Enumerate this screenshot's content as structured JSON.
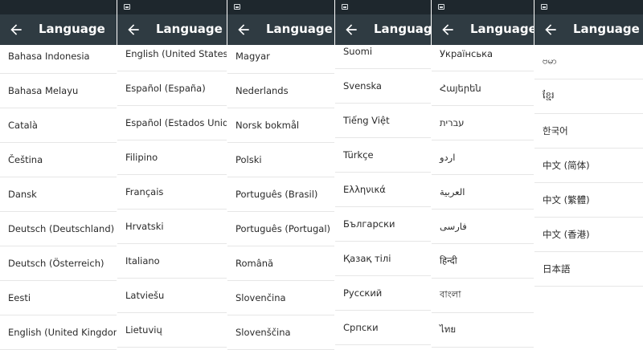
{
  "header_title": "Language",
  "panels": [
    {
      "items": [
        "Bahasa Indonesia",
        "Bahasa Melayu",
        "Català",
        "Čeština",
        "Dansk",
        "Deutsch (Deutschland)",
        "Deutsch (Österreich)",
        "Eesti",
        "English (United Kingdom)"
      ]
    },
    {
      "items": [
        "English (United States)",
        "Español (España)",
        "Español (Estados Unidos)",
        "Filipino",
        "Français",
        "Hrvatski",
        "Italiano",
        "Latviešu",
        "Lietuvių"
      ]
    },
    {
      "items": [
        "Magyar",
        "Nederlands",
        "Norsk bokmål",
        "Polski",
        "Português (Brasil)",
        "Português (Portugal)",
        "Română",
        "Slovenčina",
        "Slovenščina"
      ]
    },
    {
      "items": [
        "Suomi",
        "Svenska",
        "Tiếng Việt",
        "Türkçe",
        "Ελληνικά",
        "Български",
        "Қазақ тілі",
        "Русский",
        "Српски"
      ]
    },
    {
      "items": [
        "Українська",
        "Հայերեն",
        "עברית",
        "اردو",
        "العربية",
        "فارسی",
        "हिन्दी",
        "বাংলা",
        "ไทย"
      ]
    },
    {
      "items": [
        "ဗမာ",
        "ខ្មែរ",
        "한국어",
        "中文 (简体)",
        "中文 (繁體)",
        "中文 (香港)",
        "日本語"
      ]
    }
  ],
  "colors": {
    "status_bar": "#1e272d",
    "app_bar": "#2f3b42",
    "title_text": "#ffffff",
    "item_text": "#2a2a2a",
    "divider": "#e6e6e6"
  },
  "icons": {
    "back": "arrow-back-icon",
    "status": "image-notification-icon"
  }
}
